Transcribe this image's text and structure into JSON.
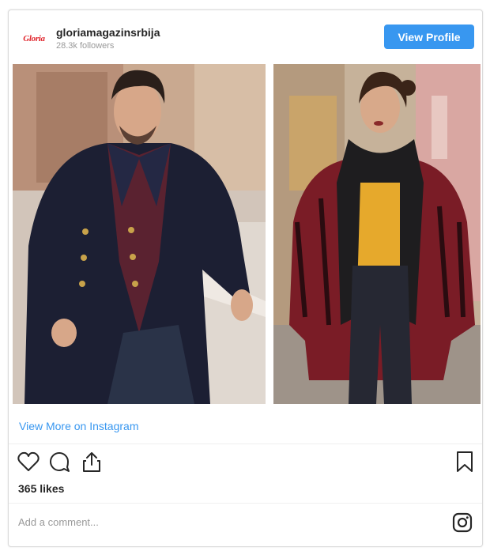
{
  "header": {
    "avatar_text": "Gloria",
    "username": "gloriamagazinsrbija",
    "followers": "28.3k followers",
    "view_profile_label": "View Profile"
  },
  "photos": {
    "left_icon": "photo-man-in-navy-coat",
    "right_icon": "photo-woman-in-yellow-top"
  },
  "view_more_label": "View More on Instagram",
  "actions": {
    "like_icon": "heart-icon",
    "comment_icon": "comment-icon",
    "share_icon": "share-icon",
    "save_icon": "bookmark-icon"
  },
  "likes": "365 likes",
  "comment_placeholder": "Add a comment...",
  "instagram_icon": "instagram-icon",
  "colors": {
    "accent": "#3897f0",
    "brand": "#e0242b",
    "muted": "#999999"
  }
}
